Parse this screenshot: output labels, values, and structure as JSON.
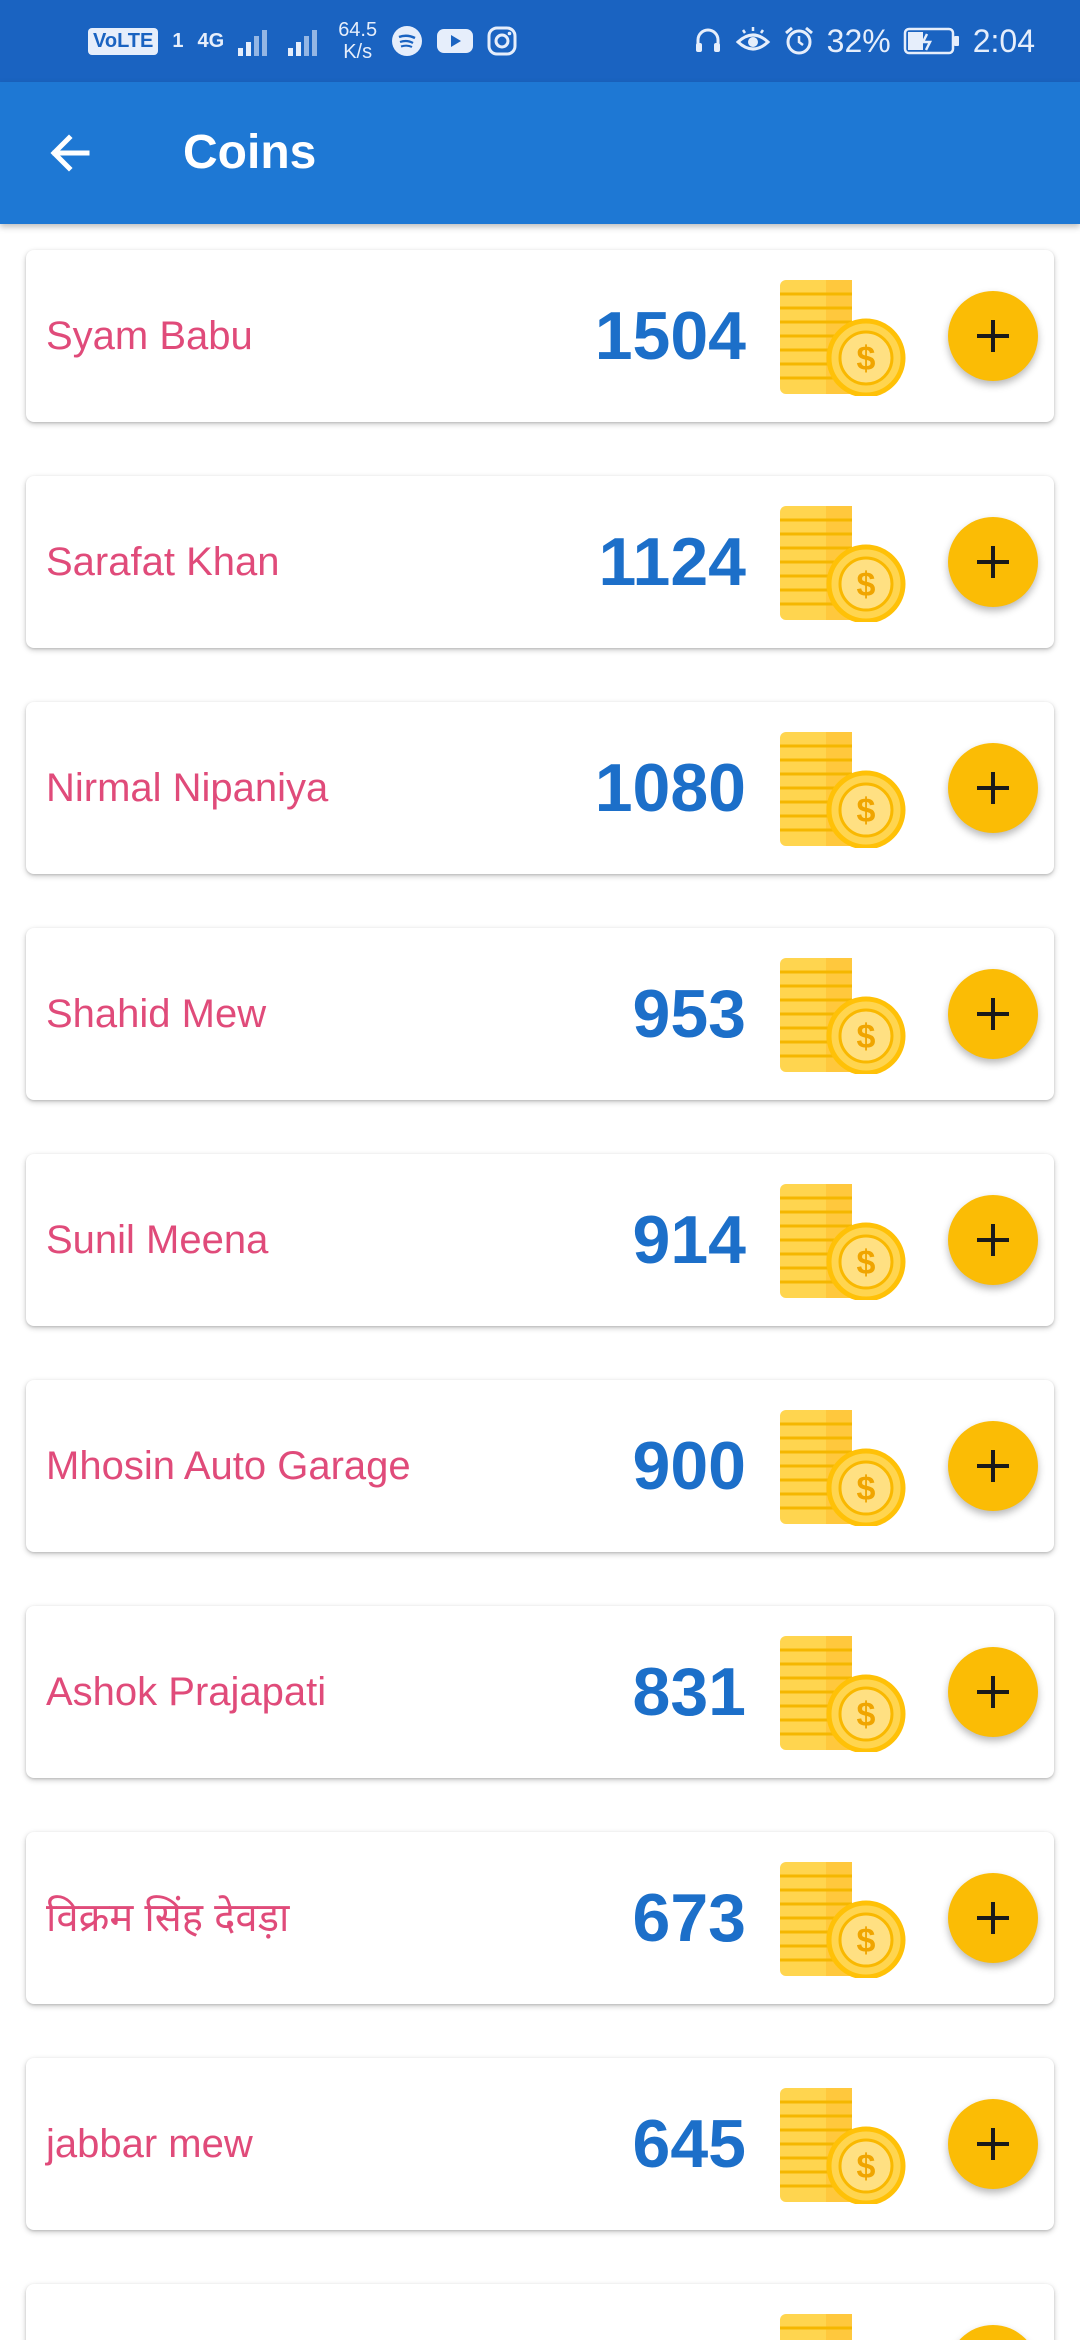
{
  "status_bar": {
    "volte": "VoLTE",
    "sim": "1",
    "network": "4G",
    "speed_value": "64.5",
    "speed_unit": "K/s",
    "battery": "32%",
    "time": "2:04"
  },
  "app_bar": {
    "title": "Coins"
  },
  "colors": {
    "status_bar": "#1a63c1",
    "app_bar": "#1e78d4",
    "name_text": "#e04b7a",
    "count_text": "#1c6fc9",
    "add_button": "#fbbc05"
  },
  "icons": {
    "back": "arrow-back-icon",
    "coin": "coin-stack-icon",
    "add": "plus-icon"
  },
  "entries": [
    {
      "name": "Syam Babu",
      "coins": "1504"
    },
    {
      "name": "Sarafat Khan",
      "coins": "1124"
    },
    {
      "name": "Nirmal Nipaniya",
      "coins": "1080"
    },
    {
      "name": "Shahid Mew",
      "coins": "953"
    },
    {
      "name": "Sunil Meena",
      "coins": "914"
    },
    {
      "name": "Mhosin Auto Garage",
      "coins": "900"
    },
    {
      "name": "Ashok Prajapati",
      "coins": "831"
    },
    {
      "name": "विक्रम सिंह देवड़ा",
      "coins": "673"
    },
    {
      "name": "jabbar mew",
      "coins": "645"
    },
    {
      "name": "",
      "coins": ""
    }
  ]
}
